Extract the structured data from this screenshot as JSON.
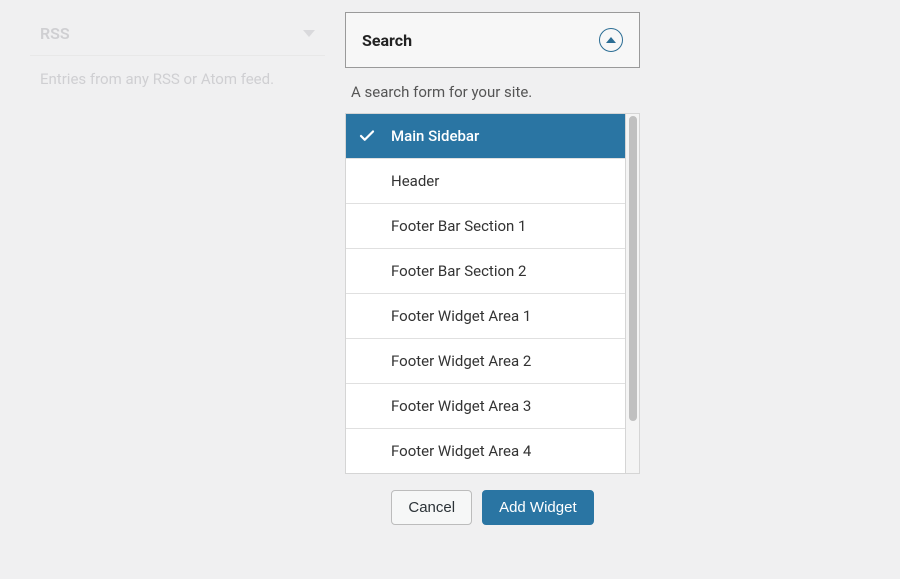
{
  "rss": {
    "title": "RSS",
    "description": "Entries from any RSS or Atom feed."
  },
  "search": {
    "title": "Search",
    "description": "A search form for your site.",
    "areas": [
      {
        "label": "Main Sidebar",
        "selected": true
      },
      {
        "label": "Header",
        "selected": false
      },
      {
        "label": "Footer Bar Section 1",
        "selected": false
      },
      {
        "label": "Footer Bar Section 2",
        "selected": false
      },
      {
        "label": "Footer Widget Area 1",
        "selected": false
      },
      {
        "label": "Footer Widget Area 2",
        "selected": false
      },
      {
        "label": "Footer Widget Area 3",
        "selected": false
      },
      {
        "label": "Footer Widget Area 4",
        "selected": false
      }
    ]
  },
  "buttons": {
    "cancel": "Cancel",
    "add": "Add Widget"
  }
}
